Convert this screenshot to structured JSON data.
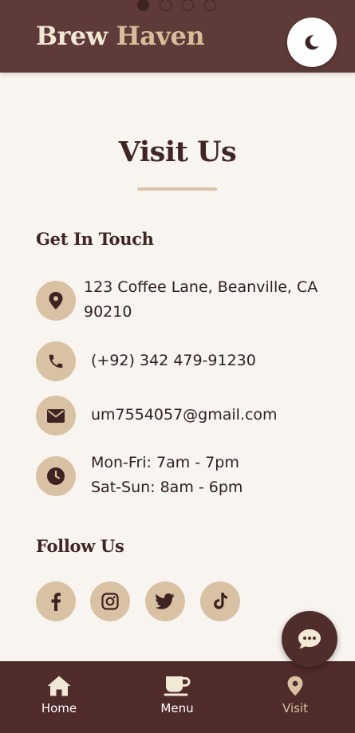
{
  "header": {
    "brand_word1": "Brew",
    "brand_word2": "Haven",
    "carousel_dots": 4,
    "theme_toggle_icon": "moon-icon"
  },
  "page": {
    "title": "Visit Us"
  },
  "contact": {
    "heading": "Get In Touch",
    "address_line1": "123 Coffee Lane, Beanville, CA",
    "address_line2": "90210",
    "phone": "(+92) 342 479-91230",
    "email": "um7554057@gmail.com",
    "hours_line1": "Mon-Fri: 7am - 7pm",
    "hours_line2": "Sat-Sun: 8am - 6pm"
  },
  "social": {
    "heading": "Follow Us",
    "networks": [
      "facebook-icon",
      "instagram-icon",
      "twitter-icon",
      "tiktok-icon"
    ]
  },
  "chat": {
    "icon": "chat-icon"
  },
  "bottom_nav": {
    "items": [
      {
        "label": "Home",
        "icon": "home-icon"
      },
      {
        "label": "Menu",
        "icon": "coffee-cup-icon"
      },
      {
        "label": "Visit",
        "icon": "location-pin-icon"
      }
    ],
    "active": "Visit"
  },
  "colors": {
    "header_bg": "#5e3a38",
    "page_bg": "#f8f4ef",
    "accent": "#d9c2a3",
    "text_dark": "#3f2523",
    "nav_bg": "#4f2b2a"
  }
}
